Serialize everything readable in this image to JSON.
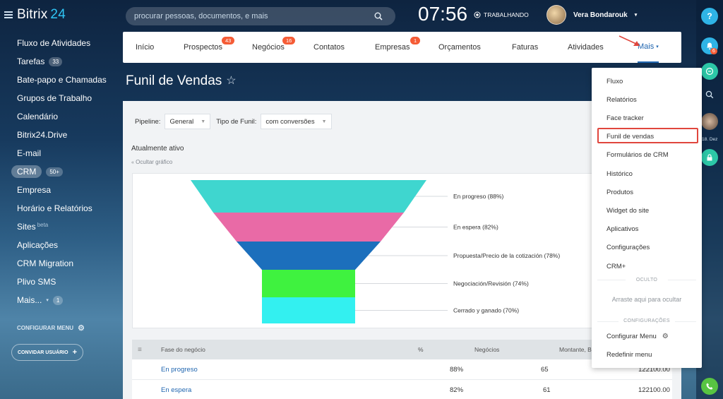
{
  "app": {
    "brand_name": "Bitrix",
    "brand_num": "24"
  },
  "search": {
    "placeholder": "procurar pessoas, documentos, e mais"
  },
  "clock": {
    "time": "07:56",
    "status": "TRABALHANDO"
  },
  "user": {
    "name": "Vera Bondarouk"
  },
  "sidebar": {
    "items": [
      {
        "label": "Fluxo de Atividades"
      },
      {
        "label": "Tarefas",
        "badge": "33"
      },
      {
        "label": "Bate-papo e Chamadas"
      },
      {
        "label": "Grupos de Trabalho"
      },
      {
        "label": "Calendário"
      },
      {
        "label": "Bitrix24.Drive"
      },
      {
        "label": "E-mail"
      },
      {
        "label": "CRM",
        "badge": "50+"
      },
      {
        "label": "Empresa"
      },
      {
        "label": "Horário e Relatórios"
      },
      {
        "label": "Sites",
        "beta": "beta"
      },
      {
        "label": "Aplicações"
      },
      {
        "label": "CRM Migration"
      },
      {
        "label": "Plivo SMS"
      },
      {
        "label": "Mais...",
        "badge": "1"
      }
    ],
    "configure_menu": "CONFIGURAR MENU",
    "invite_user": "CONVIDAR USUÁRIO"
  },
  "topnav": {
    "tabs": [
      {
        "label": "Início"
      },
      {
        "label": "Prospectos",
        "badge": "43"
      },
      {
        "label": "Negócios",
        "badge": "16"
      },
      {
        "label": "Contatos"
      },
      {
        "label": "Empresas",
        "badge": "1"
      },
      {
        "label": "Orçamentos"
      },
      {
        "label": "Faturas"
      },
      {
        "label": "Atividades"
      },
      {
        "label": "Mais"
      }
    ]
  },
  "page": {
    "title": "Funil de Vendas"
  },
  "filters": {
    "pipeline_label": "Pipeline:",
    "pipeline_value": "General",
    "funnel_type_label": "Tipo de Funil:",
    "funnel_type_value": "com conversões"
  },
  "section": {
    "active_label": "Atualmente ativo",
    "hide_chart": "Ocultar gráfico"
  },
  "chart_data": {
    "type": "funnel",
    "stages": [
      {
        "label": "En progreso (88%)",
        "value": 88,
        "color": "#3fd6cf"
      },
      {
        "label": "En espera (82%)",
        "value": 82,
        "color": "#e96aa6"
      },
      {
        "label": "Propuesta/Precio de la cotización (78%)",
        "value": 78,
        "color": "#1c6fbc"
      },
      {
        "label": "Negociación/Revisión (74%)",
        "value": 74,
        "color": "#3ff23f"
      },
      {
        "label": "Cerrado y ganado (70%)",
        "value": 70,
        "color": "#33f0f0"
      }
    ]
  },
  "table": {
    "headers": {
      "stage": "Fase do negócio",
      "percent": "%",
      "deals": "Negócios",
      "amount": "Montante, B"
    },
    "rows": [
      {
        "stage": "En progreso",
        "percent": "88%",
        "deals": "65",
        "amount": "122100.00"
      },
      {
        "stage": "En espera",
        "percent": "82%",
        "deals": "61",
        "amount": "122100.00"
      }
    ]
  },
  "dropdown": {
    "items": [
      {
        "label": "Fluxo"
      },
      {
        "label": "Relatórios"
      },
      {
        "label": "Face tracker"
      },
      {
        "label": "Funil de vendas"
      },
      {
        "label": "Formulários de CRM"
      },
      {
        "label": "Histórico"
      },
      {
        "label": "Produtos"
      },
      {
        "label": "Widget do site"
      },
      {
        "label": "Aplicativos"
      },
      {
        "label": "Configurações"
      },
      {
        "label": "CRM+"
      }
    ],
    "hidden_section": "OCULTO",
    "drag_hint": "Arraste aqui para ocultar",
    "settings_section": "CONFIGURAÇÕES",
    "configure_menu": "Configurar Menu",
    "reset_menu": "Redefinir menu"
  },
  "rail": {
    "notification_count": "6",
    "date_label": "18. Dez"
  },
  "colors": {
    "accent": "#2fc6f6",
    "badge_red": "#f55c36",
    "highlight_red": "#e0463d",
    "link": "#2066b0"
  }
}
